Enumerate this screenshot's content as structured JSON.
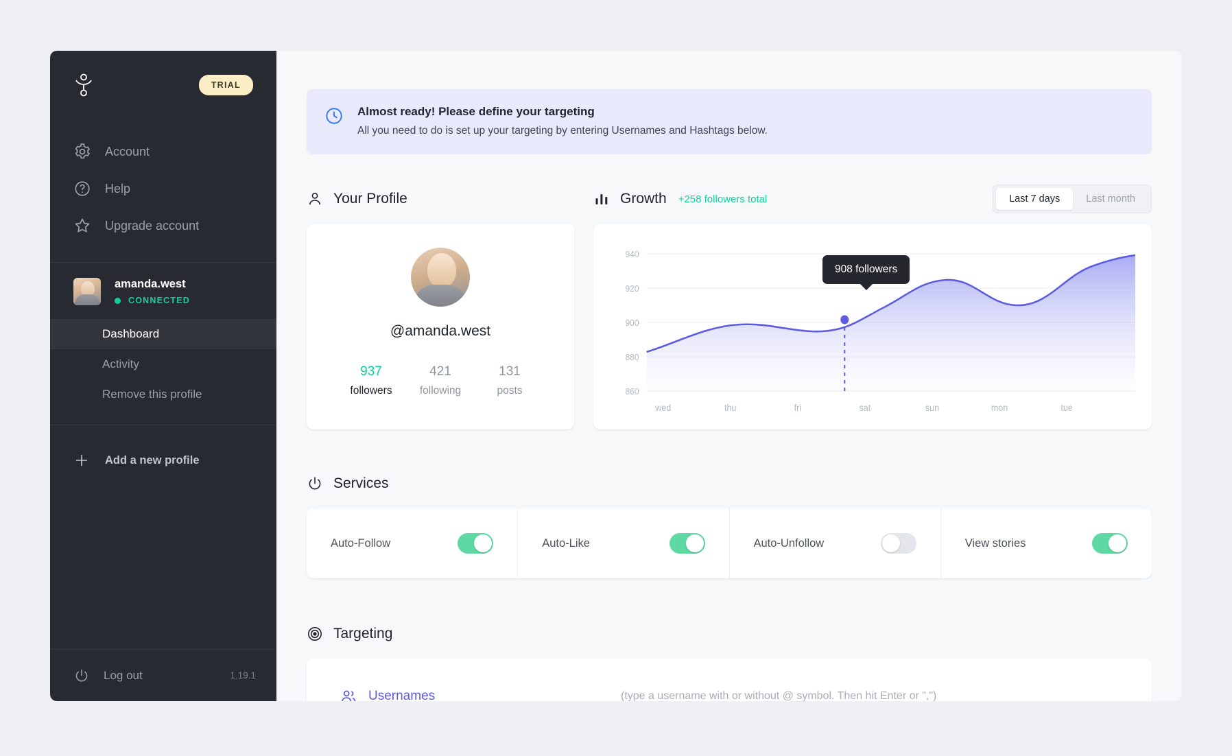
{
  "sidebar": {
    "logo_icon": "brand-logo-icon",
    "trial_badge": "TRIAL",
    "nav": [
      {
        "label": "Account",
        "icon": "gear-icon"
      },
      {
        "label": "Help",
        "icon": "question-circle-icon"
      },
      {
        "label": "Upgrade account",
        "icon": "star-icon"
      }
    ],
    "profile": {
      "name": "amanda.west",
      "status": "CONNECTED",
      "status_color": "#14cf9c",
      "sub_items": [
        {
          "label": "Dashboard",
          "active": true
        },
        {
          "label": "Activity",
          "active": false
        },
        {
          "label": "Remove this profile",
          "active": false
        }
      ]
    },
    "add_profile": {
      "label": "Add a new profile",
      "icon": "plus-icon"
    },
    "logout": {
      "label": "Log out",
      "icon": "power-icon"
    },
    "version": "1.19.1"
  },
  "alert": {
    "icon": "clock-icon",
    "title": "Almost ready! Please define your targeting",
    "subtitle": "All you need to do is set up your targeting by entering Usernames and Hashtags below.",
    "bg_color": "#e8eafb",
    "icon_color": "#3b7bf0"
  },
  "profile_section": {
    "icon": "person-icon",
    "title": "Your Profile",
    "handle": "@amanda.west",
    "stats": [
      {
        "value": "937",
        "label": "followers",
        "highlight": true
      },
      {
        "value": "421",
        "label": "following",
        "highlight": false
      },
      {
        "value": "131",
        "label": "posts",
        "highlight": false
      }
    ]
  },
  "growth_section": {
    "icon": "bar-chart-icon",
    "title": "Growth",
    "total": "+258 followers total",
    "total_color": "#14cf9c",
    "ranges": [
      {
        "label": "Last 7 days",
        "active": true
      },
      {
        "label": "Last month",
        "active": false
      }
    ],
    "tooltip": "908 followers"
  },
  "chart_data": {
    "type": "area",
    "title": "Growth",
    "xlabel": "",
    "ylabel": "",
    "x": [
      "wed",
      "thu",
      "fri",
      "sat",
      "sun",
      "mon",
      "tue"
    ],
    "categories": [
      "wed",
      "thu",
      "fri",
      "sat",
      "sun",
      "mon",
      "tue"
    ],
    "series": [
      {
        "name": "followers",
        "values": [
          883,
          897,
          895,
          912,
          919,
          913,
          936
        ]
      }
    ],
    "yticks": [
      860,
      880,
      900,
      920,
      940
    ],
    "ylim": [
      855,
      945
    ],
    "grid": true,
    "legend": "none",
    "line_color": "#5b5ce2",
    "fill_color": "#aeb0f0",
    "highlight_point": {
      "x_fraction": 0.435,
      "value": 908,
      "label": "908 followers"
    }
  },
  "services_section": {
    "icon": "power-icon",
    "title": "Services",
    "items": [
      {
        "label": "Auto-Follow",
        "on": true
      },
      {
        "label": "Auto-Like",
        "on": true
      },
      {
        "label": "Auto-Unfollow",
        "on": false
      },
      {
        "label": "View stories",
        "on": true
      }
    ]
  },
  "targeting_section": {
    "icon": "target-icon",
    "title": "Targeting",
    "row": {
      "icon": "users-icon",
      "label": "Usernames",
      "placeholder": "(type a username with or without @ symbol. Then hit Enter or \",\")",
      "value": ""
    }
  }
}
